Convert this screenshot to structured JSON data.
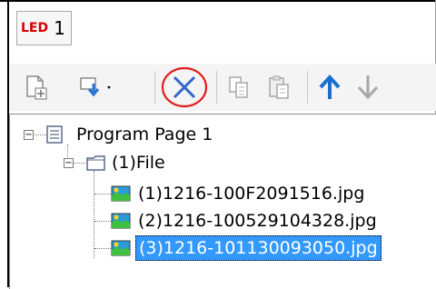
{
  "tab": {
    "icon_text": "LED",
    "label": "1",
    "icon": "led-icon"
  },
  "toolbar": {
    "buttons": [
      {
        "name": "new-page-icon"
      },
      {
        "name": "add-dropdown-icon"
      },
      {
        "name": "delete-icon"
      },
      {
        "name": "copy-icon"
      },
      {
        "name": "paste-icon"
      },
      {
        "name": "move-up-icon"
      },
      {
        "name": "move-down-icon"
      }
    ],
    "colors": {
      "delete": "#3366cc",
      "highlight_circle": "#e02020",
      "arrow_up": "#1a6fd0",
      "disabled": "#a8a8a8"
    }
  },
  "tree": {
    "root": {
      "label": "Program Page 1",
      "icon": "page-icon"
    },
    "folder": {
      "label": "(1)File",
      "icon": "folder-icon"
    },
    "files": [
      {
        "label": "(1)1216-100F2091516.jpg",
        "icon": "image-file-icon"
      },
      {
        "label": "(2)1216-100529104328.jpg",
        "icon": "image-file-icon"
      },
      {
        "label": "(3)1216-101130093050.jpg",
        "icon": "image-file-icon",
        "selected": true
      }
    ],
    "colors": {
      "selection": "#3399ff"
    }
  }
}
